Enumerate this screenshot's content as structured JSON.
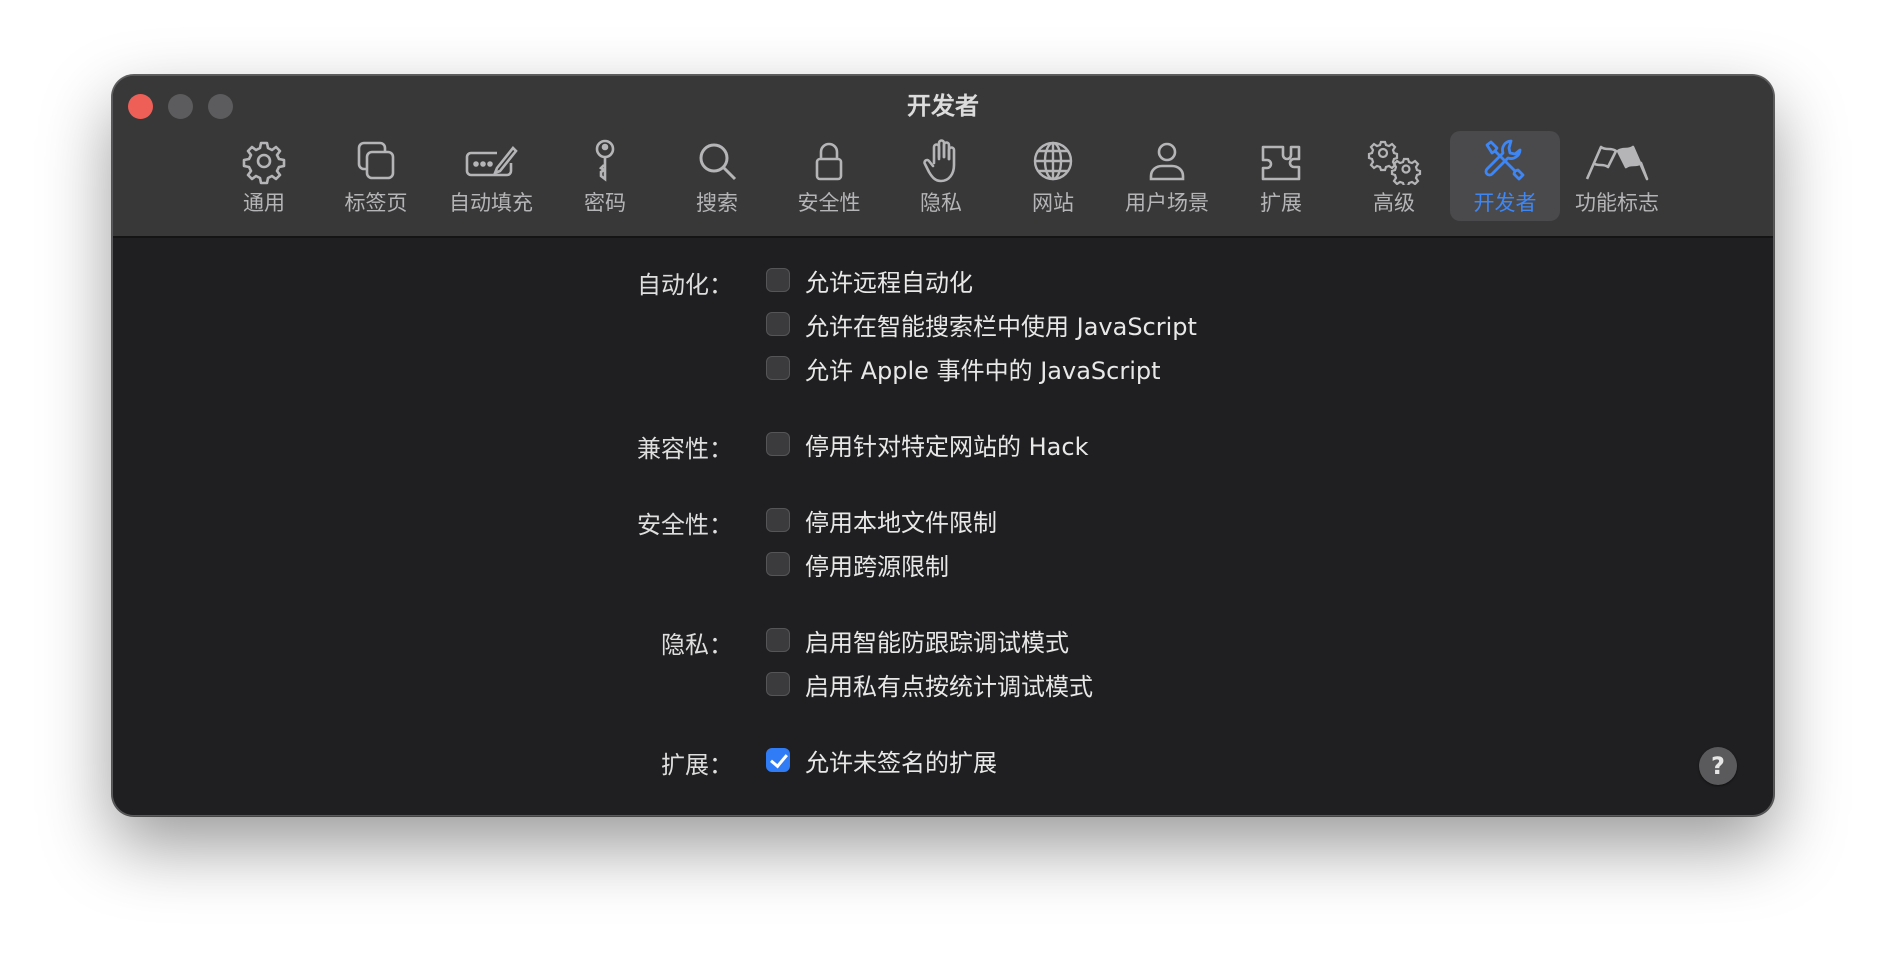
{
  "window": {
    "title": "开发者"
  },
  "toolbar": {
    "items": [
      {
        "label": "通用",
        "icon": "gear-icon"
      },
      {
        "label": "标签页",
        "icon": "tabs-icon"
      },
      {
        "label": "自动填充",
        "icon": "autofill-icon"
      },
      {
        "label": "密码",
        "icon": "key-icon"
      },
      {
        "label": "搜索",
        "icon": "search-icon"
      },
      {
        "label": "安全性",
        "icon": "lock-icon"
      },
      {
        "label": "隐私",
        "icon": "hand-icon"
      },
      {
        "label": "网站",
        "icon": "globe-icon"
      },
      {
        "label": "用户场景",
        "icon": "person-icon"
      },
      {
        "label": "扩展",
        "icon": "puzzle-icon"
      },
      {
        "label": "高级",
        "icon": "gears-icon"
      },
      {
        "label": "开发者",
        "icon": "tools-icon",
        "active": true
      },
      {
        "label": "功能标志",
        "icon": "flags-icon"
      }
    ],
    "active_color": "#3e86f4"
  },
  "groups": {
    "automation": {
      "label": "自动化：",
      "options": [
        {
          "label": "允许远程自动化",
          "checked": false
        },
        {
          "label": "允许在智能搜索栏中使用 JavaScript",
          "checked": false
        },
        {
          "label": "允许 Apple 事件中的 JavaScript",
          "checked": false
        }
      ]
    },
    "compat": {
      "label": "兼容性：",
      "options": [
        {
          "label": "停用针对特定网站的 Hack",
          "checked": false
        }
      ]
    },
    "security": {
      "label": "安全性：",
      "options": [
        {
          "label": "停用本地文件限制",
          "checked": false
        },
        {
          "label": "停用跨源限制",
          "checked": false
        }
      ]
    },
    "privacy": {
      "label": "隐私：",
      "options": [
        {
          "label": "启用智能防跟踪调试模式",
          "checked": false
        },
        {
          "label": "启用私有点按统计调试模式",
          "checked": false
        }
      ]
    },
    "extensions": {
      "label": "扩展：",
      "options": [
        {
          "label": "允许未签名的扩展",
          "checked": true
        }
      ]
    }
  },
  "help": {
    "label": "?"
  }
}
